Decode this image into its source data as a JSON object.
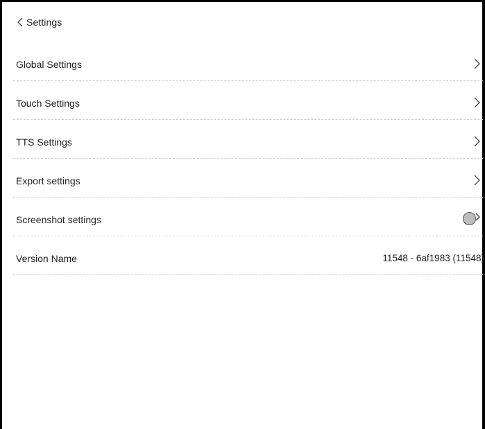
{
  "header": {
    "back_label": "Settings"
  },
  "items": [
    {
      "label": "Global Settings"
    },
    {
      "label": "Touch Settings"
    },
    {
      "label": "TTS Settings"
    },
    {
      "label": "Export settings"
    },
    {
      "label": "Screenshot settings",
      "toggle_on": false
    },
    {
      "label": "Version Name",
      "value": "11548 - 6af1983 (11548)"
    }
  ]
}
